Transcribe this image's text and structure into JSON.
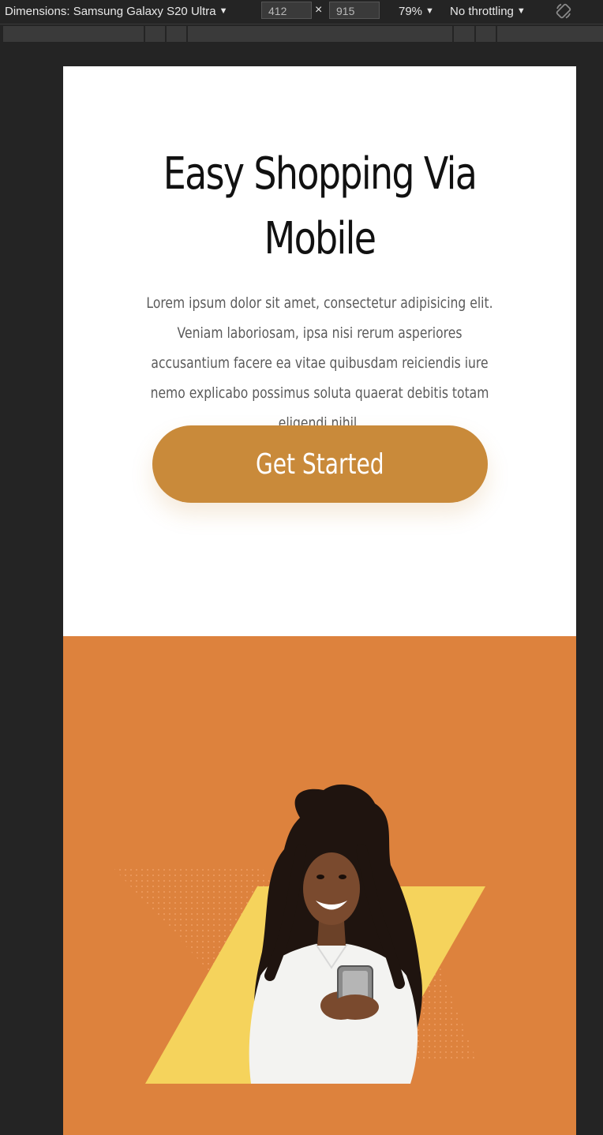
{
  "devtools": {
    "dimensions_label": "Dimensions: Samsung Galaxy S20 Ultra",
    "width_value": "412",
    "height_value": "915",
    "times_symbol": "×",
    "zoom": "79%",
    "throttling": "No throttling",
    "icons": [
      "chevron-down-icon",
      "rotate-icon"
    ]
  },
  "hero": {
    "title": "Easy Shopping Via Mobile",
    "description": "Lorem ipsum dolor sit amet, consectetur adipisicing elit. Veniam laboriosam, ipsa nisi rerum asperiores accusantium facere ea vitae quibusdam reiciendis iure nemo explicabo possimus soluta quaerat debitis totam eligendi nihil.",
    "cta_label": "Get Started"
  },
  "colors": {
    "devtools_bg": "#242424",
    "cta": "#c98a3a",
    "section_orange": "#dd823d",
    "shape_yellow": "#f5d35c"
  }
}
